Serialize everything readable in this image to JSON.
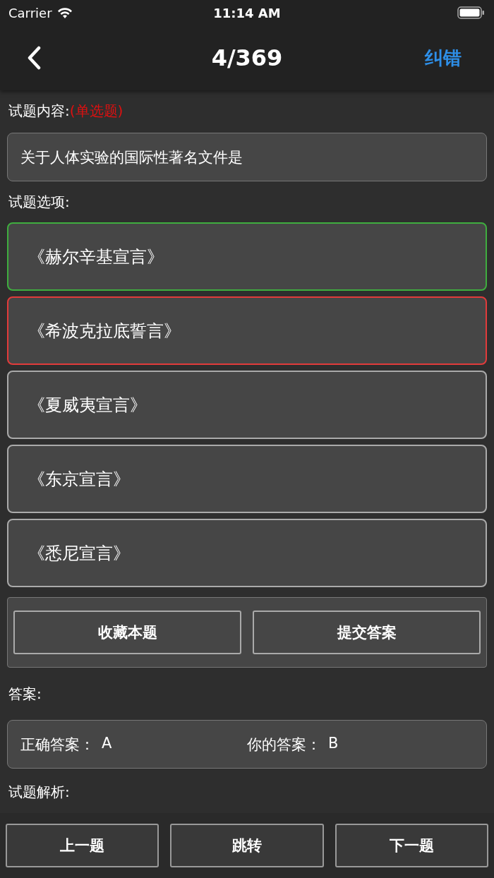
{
  "status_bar": {
    "carrier": "Carrier",
    "time": "11:14 AM"
  },
  "nav": {
    "title": "4/369",
    "action": "纠错"
  },
  "question": {
    "label": "试题内容:",
    "type": "(单选题)",
    "text": "关于人体实验的国际性著名文件是"
  },
  "options_label": "试题选项:",
  "options": [
    {
      "text": "《赫尔辛基宣言》",
      "color": "#3fae3f"
    },
    {
      "text": "《希波克拉底誓言》",
      "color": "#e23b3b"
    },
    {
      "text": "《夏威夷宣言》",
      "color": "#aaaaaa"
    },
    {
      "text": "《东京宣言》",
      "color": "#aaaaaa"
    },
    {
      "text": "《悉尼宣言》",
      "color": "#aaaaaa"
    }
  ],
  "actions": [
    "收藏本题",
    "提交答案"
  ],
  "answer": {
    "label": "答案:",
    "correct_label": "正确答案：",
    "correct": "A",
    "yours_label": "你的答案：",
    "yours": "B"
  },
  "analysis_label": "试题解析:",
  "bottom_buttons": [
    "上一题",
    "跳转",
    "下一题"
  ]
}
